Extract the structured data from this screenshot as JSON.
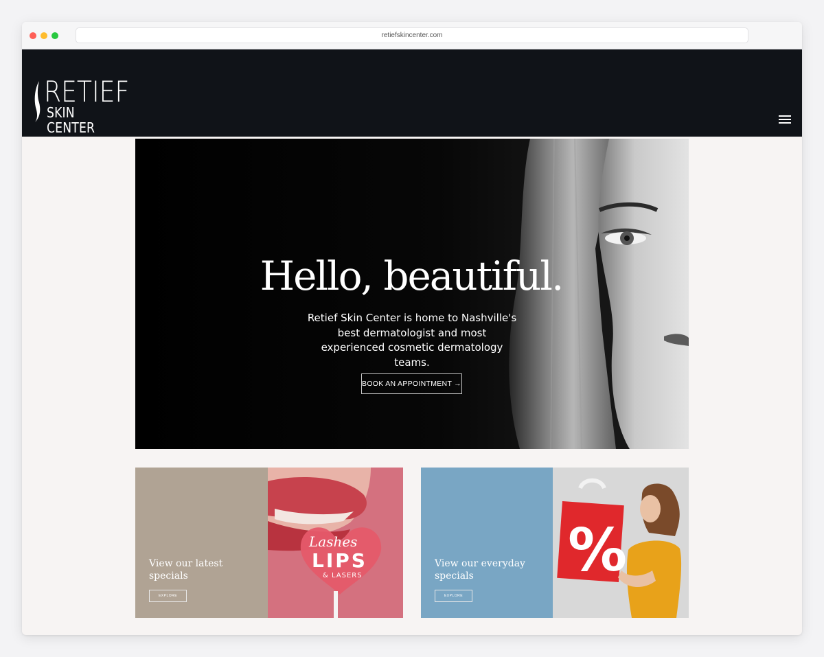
{
  "browser": {
    "url": "retiefskincenter.com"
  },
  "header": {
    "logo_line1": "RETIEF",
    "logo_line2": "SKIN CENTER"
  },
  "hero": {
    "title": "Hello, beautiful.",
    "subtitle": "Retief Skin Center is home to Nashville's best dermatologist and most experienced cosmetic dermatology teams.",
    "button_label": "BOOK AN APPOINTMENT →"
  },
  "promos": [
    {
      "text": "View our latest specials",
      "button_label": "EXPLORE",
      "image_text_script": "Lashes",
      "image_text_bold": "LIPS",
      "image_text_small": "& LASERS"
    },
    {
      "text": "View our everyday specials",
      "button_label": "EXPLORE",
      "image_symbol": "%"
    }
  ],
  "colors": {
    "header_bg": "#101318",
    "page_bg": "#f7f4f3",
    "promo_left_panel": "#b0a394",
    "promo_right_panel": "#79a6c4"
  },
  "icons": {
    "menu": "hamburger-menu-icon"
  }
}
